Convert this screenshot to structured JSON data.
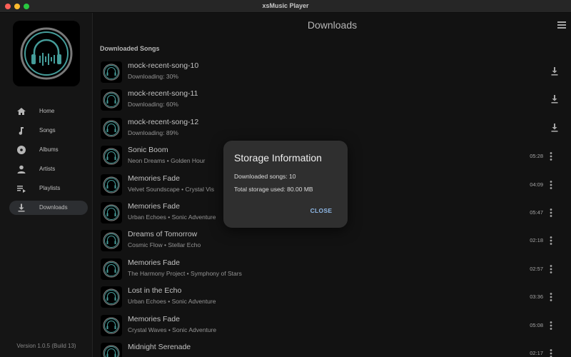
{
  "window": {
    "title": "xsMusic Player"
  },
  "sidebar": {
    "items": [
      {
        "label": "Home",
        "icon": "home-icon"
      },
      {
        "label": "Songs",
        "icon": "music-note-icon"
      },
      {
        "label": "Albums",
        "icon": "album-icon"
      },
      {
        "label": "Artists",
        "icon": "person-icon"
      },
      {
        "label": "Playlists",
        "icon": "playlist-icon"
      },
      {
        "label": "Downloads",
        "icon": "download-icon",
        "active": true
      }
    ],
    "version": "Version 1.0.5 (Build 13)"
  },
  "main": {
    "title": "Downloads",
    "section_title": "Downloaded Songs",
    "songs": [
      {
        "name": "mock-recent-song-10",
        "subtitle": "Downloading: 30%",
        "progress": 0.3,
        "action": "download-icon"
      },
      {
        "name": "mock-recent-song-11",
        "subtitle": "Downloading: 60%",
        "progress": 0.6,
        "action": "download-icon"
      },
      {
        "name": "mock-recent-song-12",
        "subtitle": "Downloading: 89%",
        "progress": 0.89,
        "action": "download-icon"
      },
      {
        "name": "Sonic Boom",
        "subtitle": "Neon Dreams • Golden Hour",
        "duration": "05:28",
        "action": "more-vert-icon"
      },
      {
        "name": "Memories Fade",
        "subtitle": "Velvet Soundscape • Crystal Vis",
        "duration": "04:09",
        "action": "more-vert-icon"
      },
      {
        "name": "Memories Fade",
        "subtitle": "Urban Echoes • Sonic Adventure",
        "duration": "05:47",
        "action": "more-vert-icon"
      },
      {
        "name": "Dreams of Tomorrow",
        "subtitle": "Cosmic Flow • Stellar Echo",
        "duration": "02:18",
        "action": "more-vert-icon"
      },
      {
        "name": "Memories Fade",
        "subtitle": "The Harmony Project • Symphony of Stars",
        "duration": "02:57",
        "action": "more-vert-icon"
      },
      {
        "name": "Lost in the Echo",
        "subtitle": "Urban Echoes • Sonic Adventure",
        "duration": "03:36",
        "action": "more-vert-icon"
      },
      {
        "name": "Memories Fade",
        "subtitle": "Crystal Waves • Sonic Adventure",
        "duration": "05:08",
        "action": "more-vert-icon"
      },
      {
        "name": "Midnight Serenade",
        "subtitle": "",
        "duration": "02:17",
        "action": "more-vert-icon"
      }
    ]
  },
  "dialog": {
    "title": "Storage Information",
    "downloaded_songs": "Downloaded songs: 10",
    "total_storage": "Total storage used: 80.00 MB",
    "close_label": "CLOSE"
  },
  "colors": {
    "accent": "#8fb8e6",
    "logo_ring": "#4fb3b0",
    "background": "#151515"
  }
}
